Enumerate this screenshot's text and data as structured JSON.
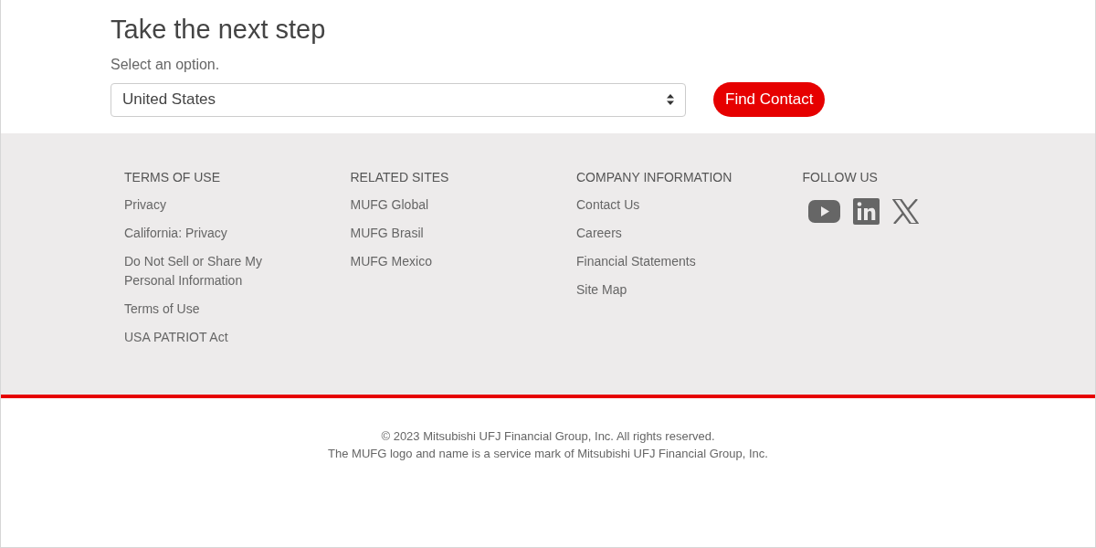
{
  "next_step": {
    "title": "Take the next step",
    "subtitle": "Select an option.",
    "select": {
      "value": "United States"
    },
    "button": "Find Contact"
  },
  "footer": {
    "columns": [
      {
        "heading": "TERMS OF USE",
        "links": [
          "Privacy",
          "California: Privacy",
          "Do Not Sell or Share My Personal Information",
          "Terms of Use",
          "USA PATRIOT Act"
        ]
      },
      {
        "heading": "RELATED SITES",
        "links": [
          "MUFG Global",
          "MUFG Brasil",
          "MUFG Mexico"
        ]
      },
      {
        "heading": "COMPANY INFORMATION",
        "links": [
          "Contact Us",
          "Careers",
          "Financial Statements",
          "Site Map"
        ]
      },
      {
        "heading": "FOLLOW US",
        "social": [
          {
            "kind": "youtube"
          },
          {
            "kind": "linkedin"
          },
          {
            "kind": "x"
          }
        ]
      }
    ]
  },
  "legal": [
    "© 2023 Mitsubishi UFJ Financial Group, Inc. All rights reserved.",
    "The MUFG logo and name is a service mark of Mitsubishi UFJ Financial Group, Inc."
  ]
}
